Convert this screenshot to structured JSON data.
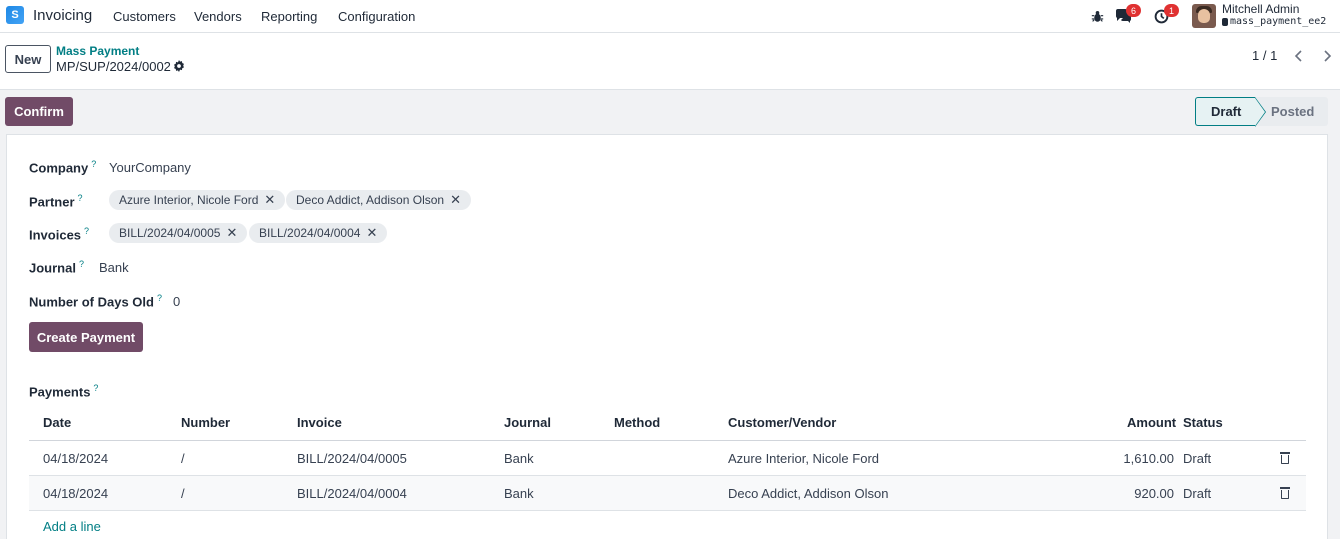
{
  "navbar": {
    "app_icon": "S",
    "app_name": "Invoicing",
    "menu": [
      "Customers",
      "Vendors",
      "Reporting",
      "Configuration"
    ],
    "messages_badge": "6",
    "activities_badge": "1",
    "user_name": "Mitchell Admin",
    "db_name": "mass_payment_ee2"
  },
  "control": {
    "new_label": "New",
    "breadcrumb_parent": "Mass Payment",
    "record_name": "MP/SUP/2024/0002",
    "pager": "1 / 1"
  },
  "status": {
    "confirm_label": "Confirm",
    "stages": [
      "Draft",
      "Posted"
    ],
    "active_stage": "Draft"
  },
  "form": {
    "company_label": "Company",
    "company_value": "YourCompany",
    "partner_label": "Partner",
    "partners": [
      "Azure Interior, Nicole Ford",
      "Deco Addict, Addison Olson"
    ],
    "invoices_label": "Invoices",
    "invoices": [
      "BILL/2024/04/0005",
      "BILL/2024/04/0004"
    ],
    "journal_label": "Journal",
    "journal_value": "Bank",
    "days_label": "Number of Days Old",
    "days_value": "0",
    "create_payment_label": "Create Payment",
    "help_mark": "?",
    "remove_mark": "✕"
  },
  "payments": {
    "label": "Payments",
    "columns": [
      "Date",
      "Number",
      "Invoice",
      "Journal",
      "Method",
      "Customer/Vendor",
      "Amount",
      "Status"
    ],
    "rows": [
      {
        "date": "04/18/2024",
        "number": "/",
        "invoice": "BILL/2024/04/0005",
        "journal": "Bank",
        "method": "",
        "partner": "Azure Interior, Nicole Ford",
        "amount": "1,610.00",
        "status": "Draft"
      },
      {
        "date": "04/18/2024",
        "number": "/",
        "invoice": "BILL/2024/04/0004",
        "journal": "Bank",
        "method": "",
        "partner": "Deco Addict, Addison Olson",
        "amount": "920.00",
        "status": "Draft"
      }
    ],
    "add_line": "Add a line"
  },
  "colors": {
    "primary": "#714b67",
    "link": "#017e84",
    "badge": "#e03131"
  }
}
